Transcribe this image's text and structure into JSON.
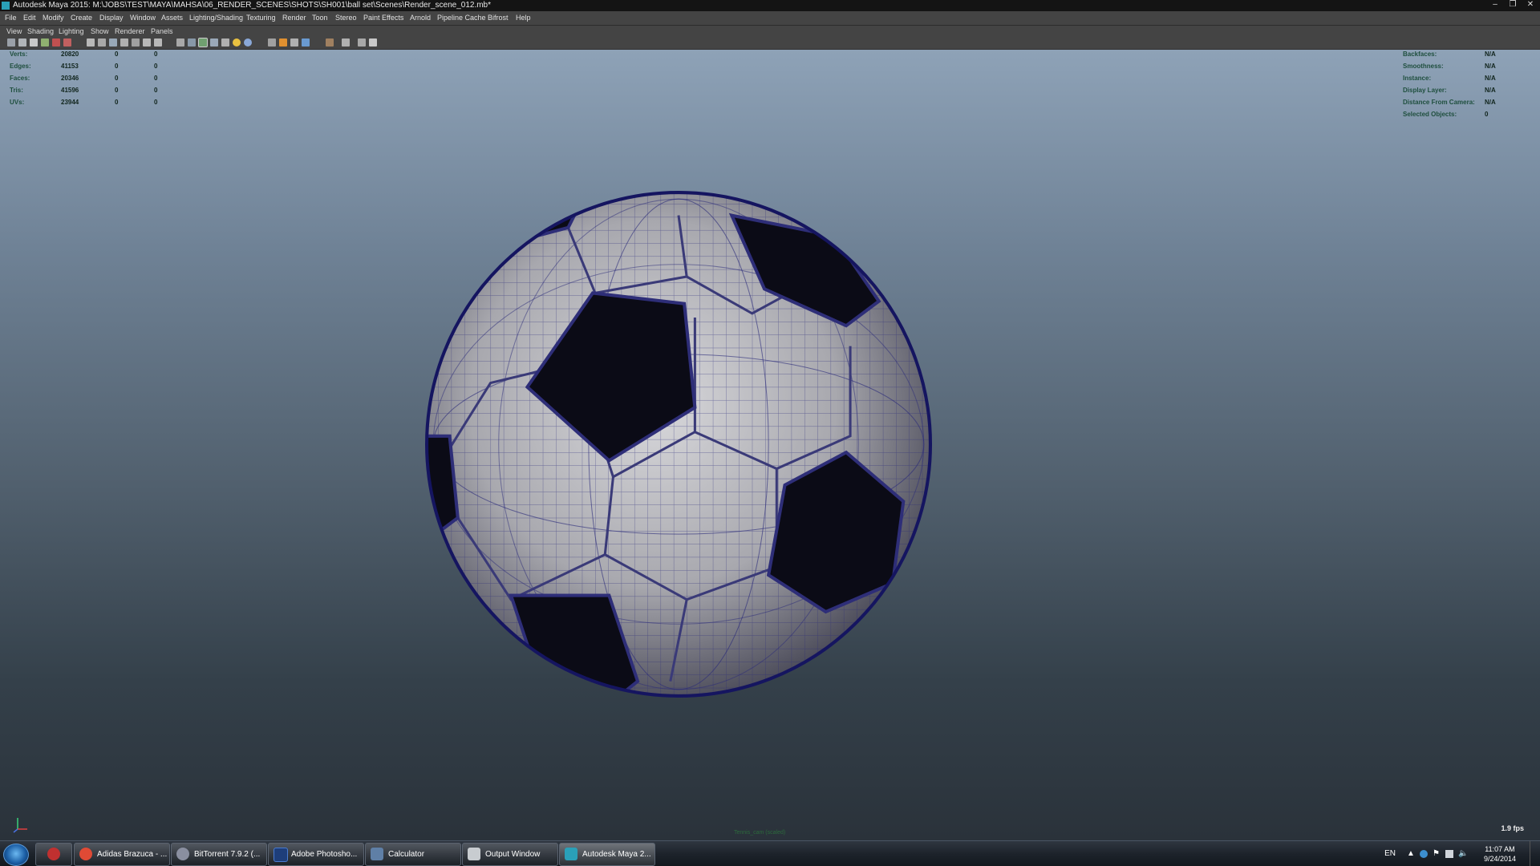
{
  "window": {
    "title": "Autodesk Maya 2015: M:\\JOBS\\TEST\\MAYA\\MAHSA\\06_RENDER_SCENES\\SHOTS\\SH001\\ball set\\Scenes\\Render_scene_012.mb*"
  },
  "menubar": [
    "File",
    "Edit",
    "Modify",
    "Create",
    "Display",
    "Window",
    "Assets",
    "Lighting/Shading",
    "Texturing",
    "Render",
    "Toon",
    "Stereo",
    "Paint Effects",
    "Arnold",
    "Pipeline Cache",
    "Bifrost",
    "Help"
  ],
  "panel_menu": [
    "View",
    "Shading",
    "Lighting",
    "Show",
    "Renderer",
    "Panels"
  ],
  "hud_left": [
    {
      "label": "Verts:",
      "v1": "20820",
      "v2": "0",
      "v3": "0"
    },
    {
      "label": "Edges:",
      "v1": "41153",
      "v2": "0",
      "v3": "0"
    },
    {
      "label": "Faces:",
      "v1": "20346",
      "v2": "0",
      "v3": "0"
    },
    {
      "label": "Tris:",
      "v1": "41596",
      "v2": "0",
      "v3": "0"
    },
    {
      "label": "UVs:",
      "v1": "23944",
      "v2": "0",
      "v3": "0"
    }
  ],
  "hud_right": [
    {
      "label": "Backfaces:",
      "value": "N/A"
    },
    {
      "label": "Smoothness:",
      "value": "N/A"
    },
    {
      "label": "Instance:",
      "value": "N/A"
    },
    {
      "label": "Display Layer:",
      "value": "N/A"
    },
    {
      "label": "Distance From Camera:",
      "value": "N/A"
    },
    {
      "label": "Selected Objects:",
      "value": "0"
    }
  ],
  "viewport": {
    "fps": "1.9 fps",
    "camera_label": "Tennis_cam (scaled)"
  },
  "taskbar": {
    "items": [
      {
        "label": "Adidas Brazuca - ...",
        "icon": "chrome-icon",
        "color": "#e04a35"
      },
      {
        "label": "BitTorrent 7.9.2 (...",
        "icon": "bittorrent-icon",
        "color": "#8a8fa0"
      },
      {
        "label": "Adobe Photosho...",
        "icon": "photoshop-icon",
        "color": "#1e3e7a"
      },
      {
        "label": "Calculator",
        "icon": "calculator-icon",
        "color": "#5f7fa6"
      },
      {
        "label": "Output Window",
        "icon": "output-window-icon",
        "color": "#c8ccd0"
      },
      {
        "label": "Autodesk Maya 2...",
        "icon": "maya-icon",
        "color": "#2aa0b8"
      }
    ],
    "lang": "EN",
    "time": "11:07 AM",
    "date": "9/24/2014"
  }
}
